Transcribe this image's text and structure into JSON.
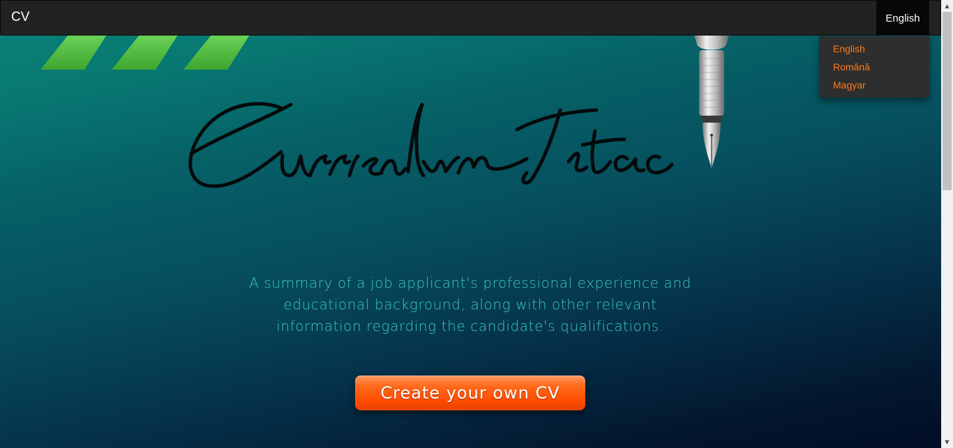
{
  "navbar": {
    "brand": "CV",
    "language_toggle": "English"
  },
  "language_menu": {
    "items": [
      {
        "label": "English"
      },
      {
        "label": "Română"
      },
      {
        "label": "Magyar"
      }
    ]
  },
  "hero": {
    "logo_text": "Curriculum Vitae",
    "summary_lines": [
      "A summary of a job applicant's professional experience and",
      "educational background, along with other relevant",
      "information regarding the candidate's qualifications."
    ],
    "cta_label": "Create your own CV"
  },
  "scrollbar": {
    "up_icon": "arrow-up-icon",
    "down_icon": "arrow-down-icon"
  },
  "colors": {
    "navbar": "#222222",
    "accent_orange": "#ff7a1a",
    "summary_teal": "#3cc9b8",
    "cta_orange": "#ff5a10",
    "stripe_green": "#5ec34a"
  }
}
